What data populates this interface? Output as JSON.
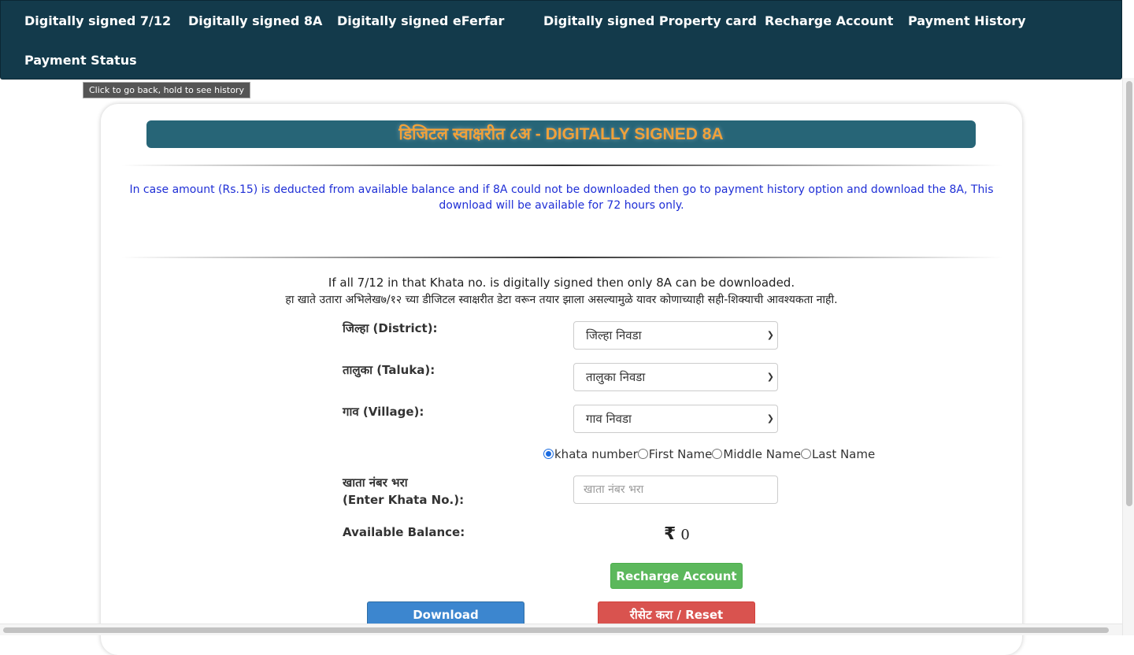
{
  "nav": {
    "items": [
      {
        "label": "Digitally signed 7/12"
      },
      {
        "label": "Digitally signed 8A"
      },
      {
        "label": "Digitally signed eFerfar"
      },
      {
        "label": "Digitally signed Property card"
      },
      {
        "label": "Recharge Account"
      },
      {
        "label": "Payment History"
      },
      {
        "label": "Payment Status"
      }
    ]
  },
  "tooltip": "Click to go back, hold to see history",
  "banner": {
    "title": "डिजिटल स्वाक्षरीत ८अ - DIGITALLY SIGNED 8A",
    "title_color": "#f0a13a",
    "bg_color": "#276577"
  },
  "notice": "In case amount (Rs.15) is deducted from available balance and if 8A could not be downloaded then go to payment history option and download the 8A, This download will be available for 72 hours only.",
  "info": {
    "en": "If all 7/12 in that Khata no. is digitally signed then only 8A can be downloaded.",
    "mr": "हा खाते उतारा अभिलेख७/१२ च्या डीजिटल स्वाक्षरीत डेटा वरून तयार झाला असल्यामुळे यावर कोणाच्याही सही-शिक्याची आवश्यकता नाही."
  },
  "form": {
    "district": {
      "label": "जिल्हा (District):",
      "selected": "जिल्हा निवडा"
    },
    "taluka": {
      "label": "तालुका (Taluka):",
      "selected": "तालुका निवडा"
    },
    "village": {
      "label": "गाव (Village):",
      "selected": "गाव निवडा"
    },
    "search_by": {
      "options": [
        "khata number",
        "First Name",
        "Middle Name",
        "Last Name"
      ],
      "selected": "khata number"
    },
    "khata": {
      "label_line1": "खाता नंबर भरा",
      "label_line2": "(Enter Khata No.):",
      "placeholder": "खाता नंबर भरा"
    },
    "balance": {
      "label": "Available Balance:",
      "currency": "₹",
      "amount": "0"
    }
  },
  "buttons": {
    "recharge": "Recharge Account",
    "download": "Download",
    "reset": "रीसेट करा / Reset"
  },
  "colors": {
    "navbar": "#133a4b",
    "notice_text": "#1f2fd6",
    "recharge_btn": "#5cb85c",
    "download_btn": "#3c86cf",
    "reset_btn": "#d9534f"
  }
}
